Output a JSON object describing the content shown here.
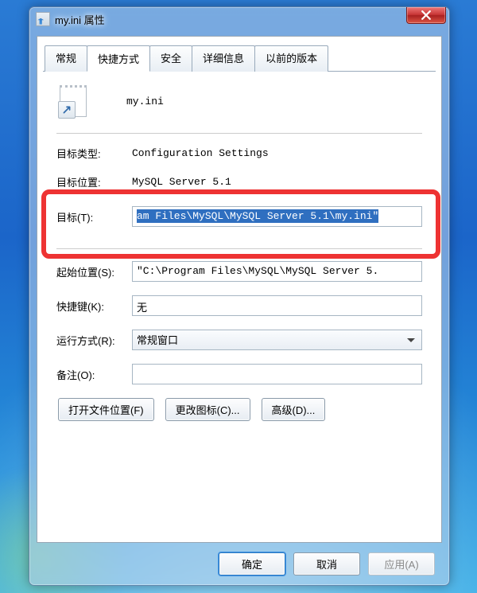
{
  "window": {
    "title": "my.ini 属性"
  },
  "tabs": {
    "general": "常规",
    "shortcut": "快捷方式",
    "security": "安全",
    "details": "详细信息",
    "previous": "以前的版本"
  },
  "file": {
    "name": "my.ini"
  },
  "labels": {
    "target_type": "目标类型:",
    "target_location": "目标位置:",
    "target": "目标(T):",
    "start_in": "起始位置(S):",
    "hotkey": "快捷键(K):",
    "run": "运行方式(R):",
    "comment": "备注(O):"
  },
  "values": {
    "target_type": "Configuration Settings",
    "target_location": "MySQL Server 5.1",
    "target": "am Files\\MySQL\\MySQL Server 5.1\\my.ini\"",
    "start_in": "\"C:\\Program Files\\MySQL\\MySQL Server 5.",
    "hotkey": "无",
    "run": "常规窗口",
    "comment": ""
  },
  "buttons": {
    "open_location": "打开文件位置(F)",
    "change_icon": "更改图标(C)...",
    "advanced": "高级(D)...",
    "ok": "确定",
    "cancel": "取消",
    "apply": "应用(A)"
  }
}
